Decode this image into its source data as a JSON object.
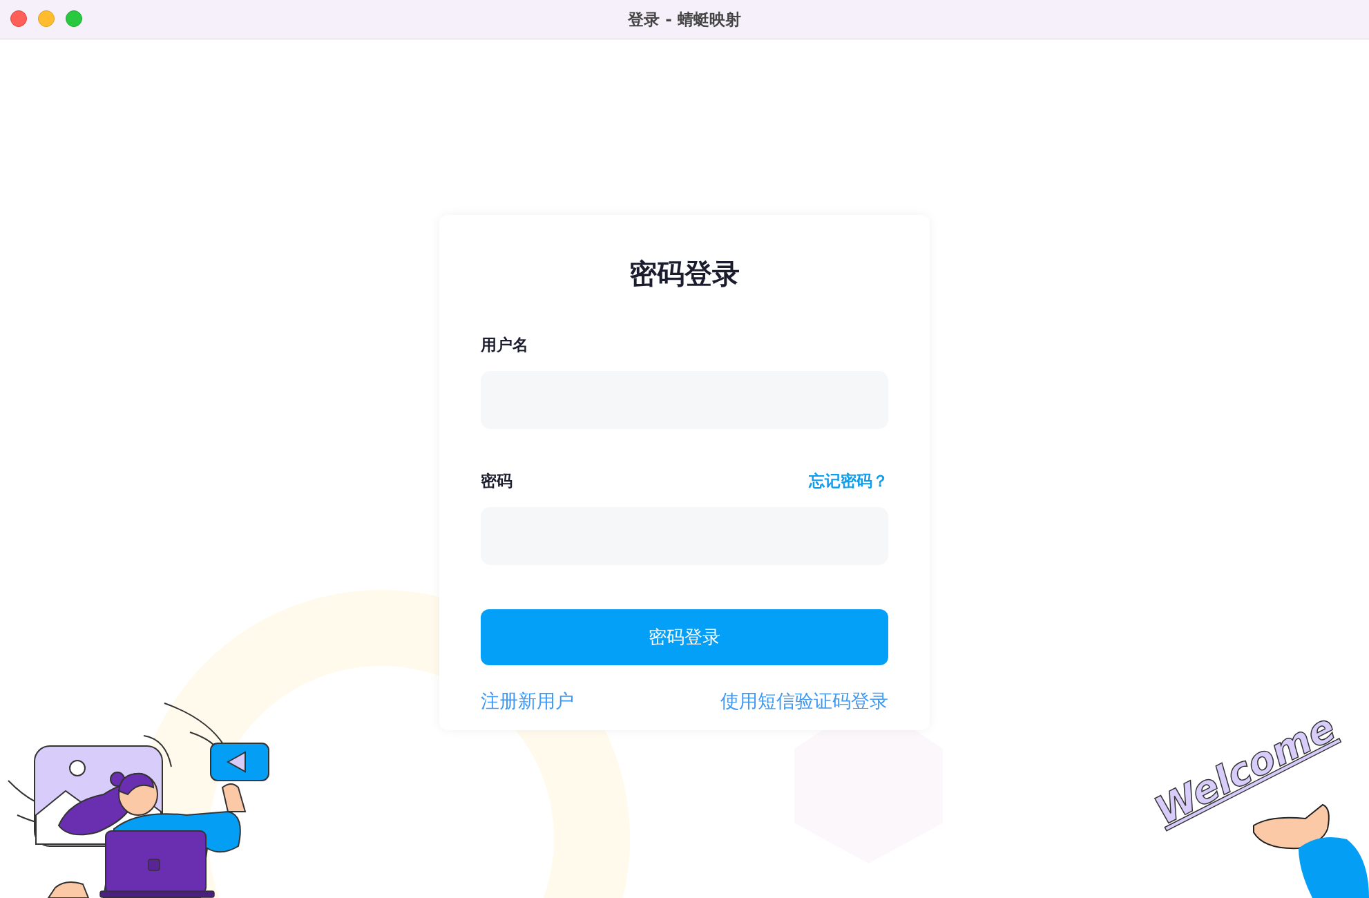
{
  "window": {
    "title": "登录 - 蜻蜓映射"
  },
  "login": {
    "heading": "密码登录",
    "fields": [
      {
        "label": "用户名"
      },
      {
        "label": "密码",
        "link": "忘记密码？"
      }
    ],
    "submit": "密码登录",
    "links": [
      "注册新用户",
      "使用短信验证码登录"
    ]
  },
  "welcome_art": {
    "text": "Welcome"
  }
}
